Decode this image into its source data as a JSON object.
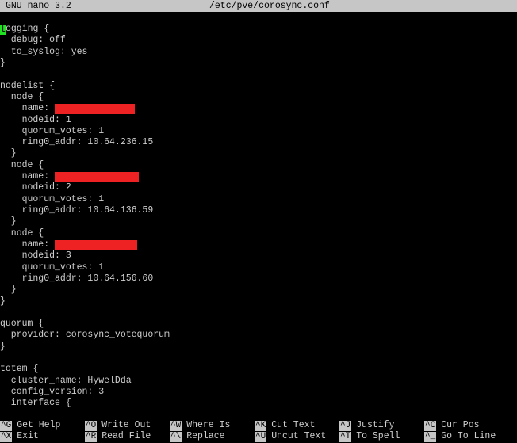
{
  "titlebar": {
    "app": "GNU nano 3.2",
    "filename": "/etc/pve/corosync.conf"
  },
  "editor": {
    "lines": [
      "logging {",
      "  debug: off",
      "  to_syslog: yes",
      "}",
      "",
      "nodelist {",
      "  node {",
      "    name: ",
      "    nodeid: 1",
      "    quorum_votes: 1",
      "    ring0_addr: 10.64.236.15",
      "  }",
      "  node {",
      "    name: ",
      "    nodeid: 2",
      "    quorum_votes: 1",
      "    ring0_addr: 10.64.136.59",
      "  }",
      "  node {",
      "    name: ",
      "    nodeid: 3",
      "    quorum_votes: 1",
      "    ring0_addr: 10.64.156.60",
      "  }",
      "}",
      "",
      "quorum {",
      "  provider: corosync_votequorum",
      "}",
      "",
      "totem {",
      "  cluster_name: HywelDda",
      "  config_version: 3",
      "  interface {"
    ],
    "cursor_char": "l",
    "first_line_rest": "ogging {",
    "redaction_color": "#ee2222",
    "cursor_color": "#22e022"
  },
  "shortcuts": {
    "row1": [
      {
        "key": "^G",
        "label": "Get Help"
      },
      {
        "key": "^O",
        "label": "Write Out"
      },
      {
        "key": "^W",
        "label": "Where Is"
      },
      {
        "key": "^K",
        "label": "Cut Text"
      },
      {
        "key": "^J",
        "label": "Justify"
      },
      {
        "key": "^C",
        "label": "Cur Pos"
      }
    ],
    "row2": [
      {
        "key": "^X",
        "label": "Exit"
      },
      {
        "key": "^R",
        "label": "Read File"
      },
      {
        "key": "^\\",
        "label": "Replace"
      },
      {
        "key": "^U",
        "label": "Uncut Text"
      },
      {
        "key": "^T",
        "label": "To Spell"
      },
      {
        "key": "^_",
        "label": "Go To Line"
      }
    ]
  }
}
